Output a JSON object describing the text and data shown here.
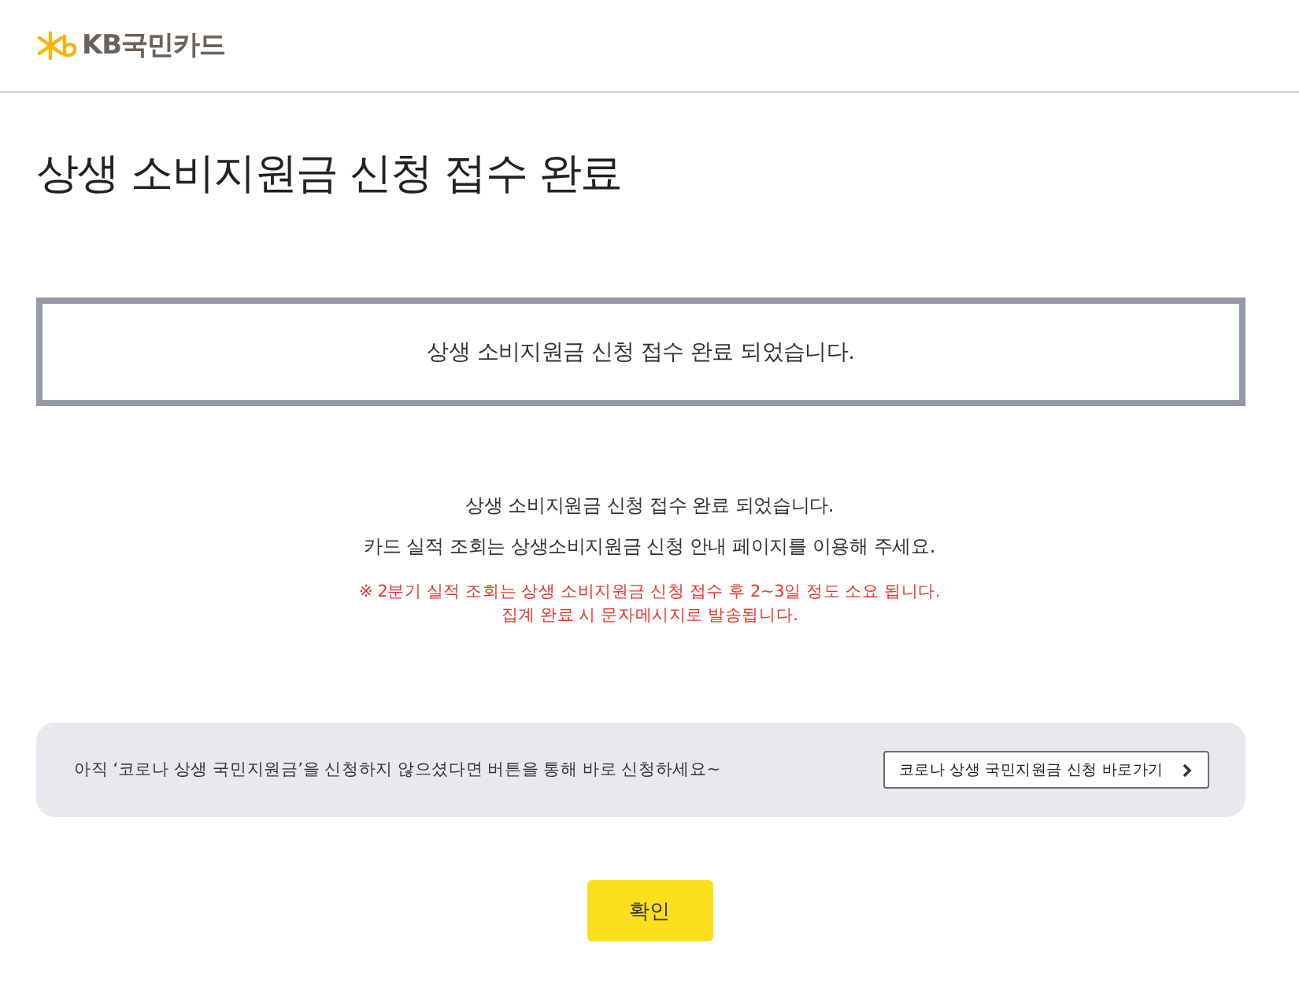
{
  "header": {
    "logo_text": "KB국민카드"
  },
  "page_title": "상생 소비지원금 신청 접수 완료",
  "result_box": {
    "message": "상생 소비지원금 신청 접수 완료 되었습니다."
  },
  "notices": [
    {
      "kind": "normal",
      "text": "상생 소비지원금 신청 접수 완료 되었습니다."
    },
    {
      "kind": "normal",
      "text": "카드 실적 조회는 상생소비지원금 신청 안내 페이지를 이용해 주세요."
    },
    {
      "kind": "warning",
      "text": "※ 2분기 실적 조회는 상생 소비지원금 신청 접수 후 2~3일 정도 소요 됩니다."
    },
    {
      "kind": "warning",
      "text": "집계 완료 시 문자메시지로 발송됩니다."
    }
  ],
  "apply_banner": {
    "text": "아직 ‘코로나 상생 국민지원금’을 신청하지 않으셨다면 버튼을 통해 바로 신청하세요~",
    "button": "코로나 상생 국민지원금 신청 바로가기"
  },
  "confirm_button": "확인"
}
